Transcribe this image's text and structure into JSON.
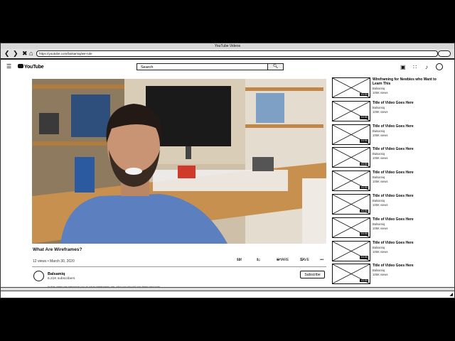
{
  "window": {
    "title": "YouTube Videos"
  },
  "browser": {
    "url": "https://youtube.com/balsamiq/we-rule",
    "back_icon": "arrow-left-icon",
    "forward_icon": "arrow-right-icon",
    "close_icon": "close-icon",
    "home_icon": "home-icon"
  },
  "header": {
    "logo_text": "YouTube",
    "search_placeholder": "Search",
    "search_icon": "search-icon",
    "camera_icon": "video-camera-icon",
    "apps_icon": "grid-icon",
    "bell_icon": "bell-icon",
    "avatar_icon": "user-icon"
  },
  "video": {
    "title": "What Are Wireframes?",
    "meta": "12 views • March 30, 2020",
    "likes": "1M",
    "dislikes": "1",
    "share_label": "SHARE",
    "save_label": "SAVE",
    "more_label": "•••"
  },
  "channel": {
    "name": "Balsamiq",
    "subscribers": "6.21K subscribers",
    "subscribe_label": "Subscribe",
    "description": "In this video we introduce you to what wireframes are, why you should use them and how"
  },
  "related": [
    {
      "title": "Wireframing for Newbies who Want to Learn This",
      "channel": "Balsamiq",
      "views": "105K views",
      "duration": "16:50"
    },
    {
      "title": "Title of Video Goes Here",
      "channel": "Balsamiq",
      "views": "105K views",
      "duration": "16:50"
    },
    {
      "title": "Title of Video Goes Here",
      "channel": "Balsamiq",
      "views": "105K views",
      "duration": "16:50"
    },
    {
      "title": "Title of Video Goes Here",
      "channel": "Balsamiq",
      "views": "105K views",
      "duration": "16:50"
    },
    {
      "title": "Title of Video Goes Here",
      "channel": "Balsamiq",
      "views": "105K views",
      "duration": "16:50"
    },
    {
      "title": "Title of Video Goes Here",
      "channel": "Balsamiq",
      "views": "105K views",
      "duration": "16:50"
    },
    {
      "title": "Title of Video Goes Here",
      "channel": "Balsamiq",
      "views": "105K views",
      "duration": "16:50"
    },
    {
      "title": "Title of Video Goes Here",
      "channel": "Balsamiq",
      "views": "105K views",
      "duration": "16:50"
    },
    {
      "title": "Title of Video Goes Here",
      "channel": "Balsamiq",
      "views": "105K views",
      "duration": "16:50"
    }
  ]
}
